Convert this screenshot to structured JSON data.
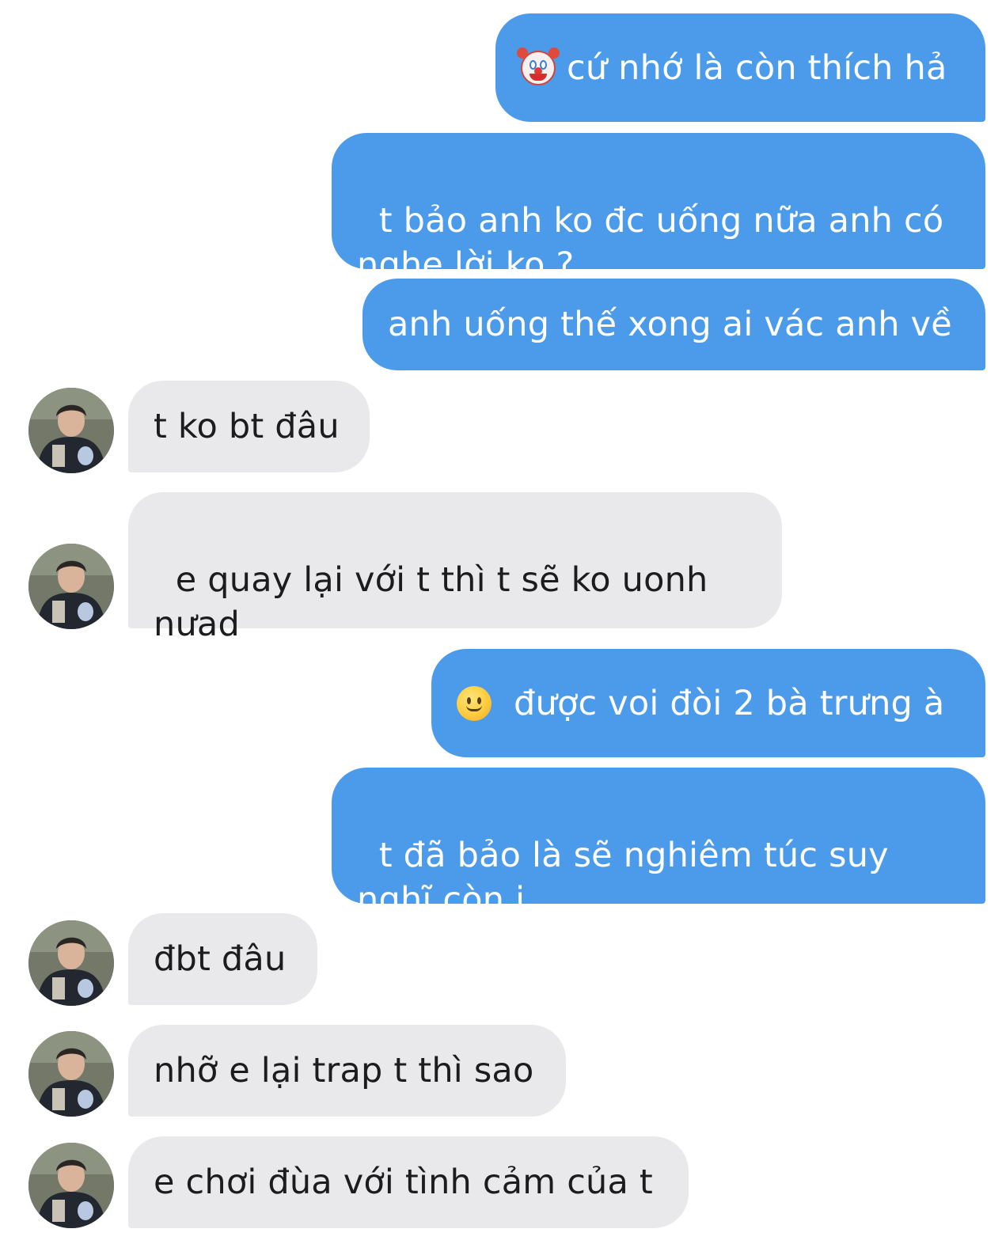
{
  "messages": [
    {
      "sender": "me",
      "emoji": "clown-face",
      "text": "cứ nhớ là còn thích hả"
    },
    {
      "sender": "me",
      "text": "t bảo anh ko đc uống nữa anh có\nnghe lời ko ?"
    },
    {
      "sender": "me",
      "text": "anh uống thế xong ai vác anh về"
    },
    {
      "sender": "them",
      "text": "t ko bt đâu"
    },
    {
      "sender": "them",
      "text": "e quay lại với t thì t sẽ ko uonh\nnưad"
    },
    {
      "sender": "me",
      "emoji": "slightly-smiling-face",
      "text": "được voi đòi 2 bà trưng à"
    },
    {
      "sender": "me",
      "text": "t đã bảo là sẽ nghiêm túc suy\nnghĩ còn j"
    },
    {
      "sender": "them",
      "text": "đbt đâu"
    },
    {
      "sender": "them",
      "text": "nhỡ e lại trap t thì sao"
    },
    {
      "sender": "them",
      "text": "e chơi đùa với tình cảm của t"
    }
  ],
  "colors": {
    "outgoing_bubble": "#4c9bea",
    "incoming_bubble": "#e9e9eb",
    "outgoing_text": "#ffffff",
    "incoming_text": "#1c1c1e"
  }
}
